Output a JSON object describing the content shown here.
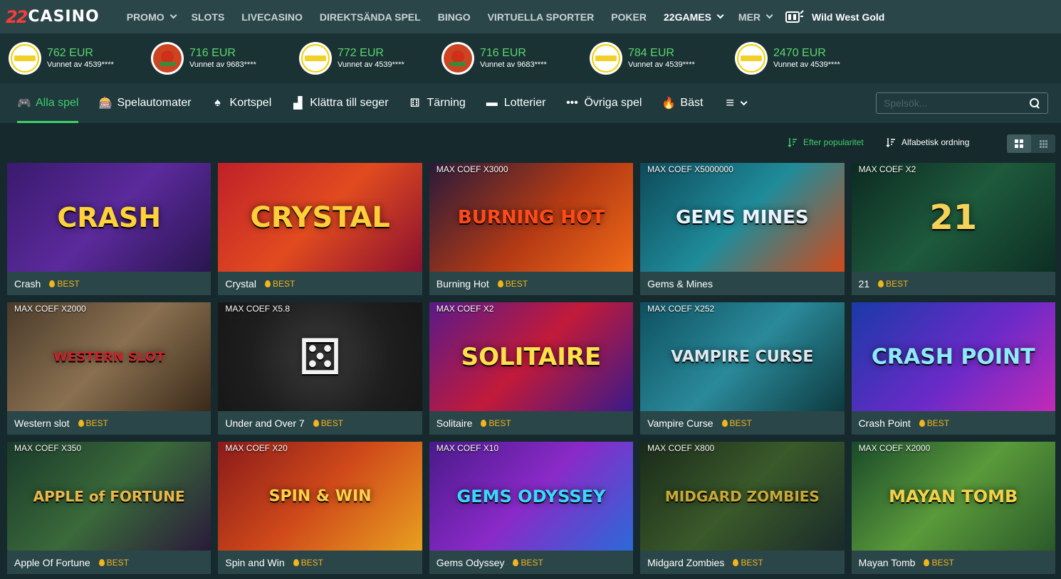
{
  "nav": {
    "logo_num": "22",
    "logo_word": "CASINO",
    "items": [
      {
        "label": "PROMO",
        "dropdown": true,
        "white": false
      },
      {
        "label": "SLOTS",
        "dropdown": false,
        "white": false
      },
      {
        "label": "LIVECASINO",
        "dropdown": false,
        "white": false
      },
      {
        "label": "DIREKTSÄNDA SPEL",
        "dropdown": false,
        "white": false
      },
      {
        "label": "BINGO",
        "dropdown": false,
        "white": false
      },
      {
        "label": "VIRTUELLA SPORTER",
        "dropdown": false,
        "white": false
      },
      {
        "label": "POKER",
        "dropdown": false,
        "white": false
      },
      {
        "label": "22GAMES",
        "dropdown": true,
        "white": true
      },
      {
        "label": "MER",
        "dropdown": true,
        "white": false
      }
    ],
    "promo_game": "Wild West Gold"
  },
  "winners": [
    {
      "amount": "762 EUR",
      "who": "Vunnet av 4539****",
      "game": "crash"
    },
    {
      "amount": "716 EUR",
      "who": "Vunnet av 9683****",
      "game": "wwg"
    },
    {
      "amount": "772 EUR",
      "who": "Vunnet av 4539****",
      "game": "crash"
    },
    {
      "amount": "716 EUR",
      "who": "Vunnet av 9683****",
      "game": "wwg"
    },
    {
      "amount": "784 EUR",
      "who": "Vunnet av 4539****",
      "game": "crash"
    },
    {
      "amount": "2470 EUR",
      "who": "Vunnet av 4539****",
      "game": "crash"
    }
  ],
  "categories": [
    {
      "label": "Alla spel",
      "icon": "gamepad-icon",
      "glyph": "🎮",
      "active": true
    },
    {
      "label": "Spelautomater",
      "icon": "slot-icon",
      "glyph": "🎰",
      "active": false
    },
    {
      "label": "Kortspel",
      "icon": "spade-icon",
      "glyph": "♠",
      "active": false
    },
    {
      "label": "Klättra till seger",
      "icon": "stairs-icon",
      "glyph": "▟",
      "active": false
    },
    {
      "label": "Tärning",
      "icon": "dice-icon",
      "glyph": "⚅",
      "active": false
    },
    {
      "label": "Lotterier",
      "icon": "ticket-icon",
      "glyph": "▬",
      "active": false
    },
    {
      "label": "Övriga spel",
      "icon": "dots-icon",
      "glyph": "•••",
      "active": false
    },
    {
      "label": "Bäst",
      "icon": "fire-icon",
      "glyph": "🔥",
      "active": false
    }
  ],
  "more_menu_icon": "≡",
  "search": {
    "placeholder": "Spelsök..."
  },
  "sort": {
    "popularity": "Efter popularitet",
    "alphabetical": "Alfabetisk ordning"
  },
  "best_label": "BEST",
  "games": [
    {
      "name": "Crash",
      "coef": "",
      "best": true,
      "art_title": "CRASH",
      "bg": "linear-gradient(135deg,#3a1a6e,#5b2a9c 50%,#2a1550)",
      "tc": "#ffd23a",
      "ts": "38px"
    },
    {
      "name": "Crystal",
      "coef": "",
      "best": true,
      "art_title": "CRYSTAL",
      "bg": "linear-gradient(135deg,#c0202a,#e14b1f 50%,#8a1030)",
      "tc": "#ffcf3a",
      "ts": "40px"
    },
    {
      "name": "Burning Hot",
      "coef": "MAX COEF X3000",
      "best": true,
      "art_title": "BURNING HOT",
      "bg": "linear-gradient(135deg,#2a1a3a,#b43a14 55%,#f06a18)",
      "tc": "#ff4a1a",
      "ts": "26px"
    },
    {
      "name": "Gems & Mines",
      "coef": "MAX COEF X5000000",
      "best": false,
      "art_title": "GEMS MINES",
      "bg": "linear-gradient(135deg,#0e4a5a,#1f8c9a 50%,#d04a1a)",
      "tc": "#e8f4ff",
      "ts": "26px"
    },
    {
      "name": "21",
      "coef": "MAX COEF X2",
      "best": true,
      "art_title": "21",
      "bg": "linear-gradient(135deg,#0c2a22,#1e5a3c 50%,#0d2e24)",
      "tc": "#f4d25a",
      "ts": "48px"
    },
    {
      "name": "Western slot",
      "coef": "MAX COEF X2000",
      "best": true,
      "art_title": "WESTERN SLOT",
      "bg": "linear-gradient(135deg,#4a3a2a,#8a7050 50%,#3a2a1a)",
      "tc": "#c8242a",
      "ts": "18px"
    },
    {
      "name": "Under and Over 7",
      "coef": "MAX COEF X5.8",
      "best": true,
      "art_title": "⚄",
      "bg": "radial-gradient(circle at 50% 50%,#3a3a3a,#1e1e1e 60%,#171717)",
      "tc": "#f2f2f2",
      "ts": "70px"
    },
    {
      "name": "Solitaire",
      "coef": "MAX COEF X2",
      "best": true,
      "art_title": "SOLITAIRE",
      "bg": "linear-gradient(135deg,#5a1a8a,#c21a3a 50%,#3a1a8a)",
      "tc": "#ffe04a",
      "ts": "34px"
    },
    {
      "name": "Vampire Curse",
      "coef": "MAX COEF X252",
      "best": true,
      "art_title": "VAMPIRE CURSE",
      "bg": "linear-gradient(135deg,#0e5060,#2a8a9a 50%,#0e3a40)",
      "tc": "#dfe8ef",
      "ts": "22px"
    },
    {
      "name": "Crash Point",
      "coef": "",
      "best": true,
      "art_title": "CRASH POINT",
      "bg": "linear-gradient(135deg,#1a3aa8,#6a2ac8 55%,#c22ab8)",
      "tc": "#8ee8ff",
      "ts": "30px"
    },
    {
      "name": "Apple Of Fortune",
      "coef": "MAX COEF X350",
      "best": true,
      "art_title": "APPLE of FORTUNE",
      "bg": "linear-gradient(135deg,#1a3a2a,#3a6a3a 50%,#2a1a3a)",
      "tc": "#e8b84a",
      "ts": "20px"
    },
    {
      "name": "Spin and Win",
      "coef": "MAX COEF X20",
      "best": true,
      "art_title": "SPIN & WIN",
      "bg": "linear-gradient(135deg,#8a1a1a,#d04a1a 50%,#e8a020)",
      "tc": "#ffd04a",
      "ts": "22px"
    },
    {
      "name": "Gems Odyssey",
      "coef": "MAX COEF X10",
      "best": true,
      "art_title": "GEMS ODYSSEY",
      "bg": "linear-gradient(135deg,#4a1a8a,#8a2ac8 50%,#2a6ad8)",
      "tc": "#3ad8ff",
      "ts": "24px"
    },
    {
      "name": "Midgard Zombies",
      "coef": "MAX COEF X800",
      "best": true,
      "art_title": "MIDGARD ZOMBIES",
      "bg": "linear-gradient(135deg,#1a2a1a,#3a5a2a 50%,#1a2a2a)",
      "tc": "#c8a83a",
      "ts": "20px"
    },
    {
      "name": "Mayan Tomb",
      "coef": "MAX COEF X2000",
      "best": true,
      "art_title": "MAYAN TOMB",
      "bg": "linear-gradient(135deg,#1a4a2a,#5a9a3a 50%,#2a5a2a)",
      "tc": "#f2d24a",
      "ts": "24px"
    }
  ],
  "colors": {
    "accent": "#3fcf6b",
    "best": "#f2b51c",
    "nav_bg": "#2b4649",
    "page_bg": "#16292c"
  }
}
